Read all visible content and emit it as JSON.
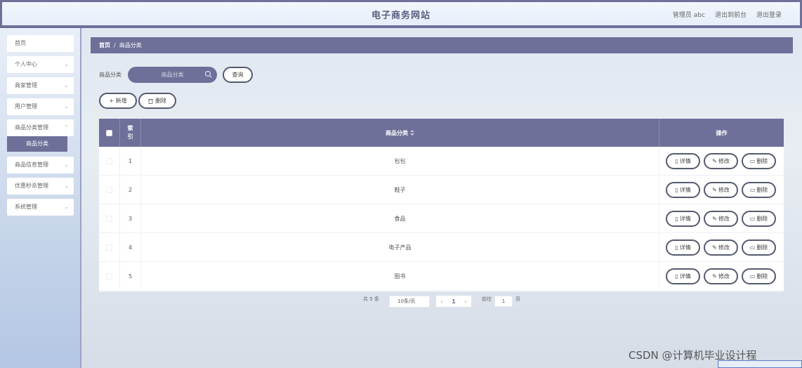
{
  "header": {
    "title": "电子商务网站",
    "user_label": "管理员 abc",
    "back_label": "退出到前台",
    "logout_label": "退出登录"
  },
  "sidebar": {
    "items": [
      {
        "label": "首页"
      },
      {
        "label": "个人中心"
      },
      {
        "label": "商家管理"
      },
      {
        "label": "用户管理"
      },
      {
        "label": "商品分类管理"
      },
      {
        "label": "商品信息管理"
      },
      {
        "label": "优惠秒杀管理"
      },
      {
        "label": "系统管理"
      }
    ],
    "active_sub": "商品分类"
  },
  "breadcrumb": {
    "home": "首页",
    "sep": "/",
    "current": "商品分类"
  },
  "search": {
    "label": "商品分类",
    "placeholder": "商品分类",
    "query_label": "查询"
  },
  "actions": {
    "add_label": "+ 新增",
    "delete_label": "删除"
  },
  "table": {
    "headers": {
      "index": "索引",
      "category": "商品分类",
      "sort_icon": "sort-icon",
      "ops": "操作"
    },
    "rows": [
      {
        "index": "1",
        "category": "包包"
      },
      {
        "index": "2",
        "category": "鞋子"
      },
      {
        "index": "3",
        "category": "食品"
      },
      {
        "index": "4",
        "category": "电子产品"
      },
      {
        "index": "5",
        "category": "图书"
      }
    ],
    "op_labels": {
      "detail": "详情",
      "edit": "修改",
      "delete": "删除"
    }
  },
  "pagination": {
    "total": "共 5 条",
    "page_size": "10条/页",
    "current_page": "1",
    "goto_label": "前往",
    "goto_value": "1",
    "page_unit": "页"
  },
  "watermark": "CSDN @计算机毕业设计程",
  "colors": {
    "accent": "#6e7099",
    "sidebar_bg": "#c7d5ea"
  }
}
